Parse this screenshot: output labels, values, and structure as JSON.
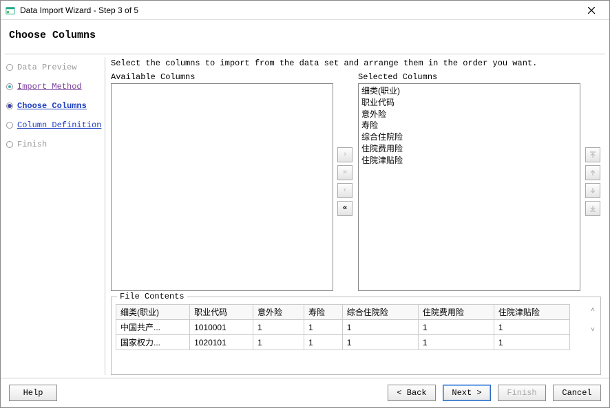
{
  "window": {
    "title": "Data Import Wizard - Step 3 of 5",
    "close_tooltip": "Close"
  },
  "header": {
    "heading": "Choose Columns"
  },
  "nav": {
    "items": [
      {
        "label": "Data Preview",
        "state": "visited_disabled"
      },
      {
        "label": "Import Method",
        "state": "visited"
      },
      {
        "label": "Choose Columns",
        "state": "current"
      },
      {
        "label": "Column Definition",
        "state": "link"
      },
      {
        "label": "Finish",
        "state": "disabled"
      }
    ]
  },
  "main": {
    "instruction": "Select the columns to import from the data set and arrange them in the order you want.",
    "available_label": "Available Columns",
    "selected_label": "Selected Columns",
    "available_columns": [],
    "selected_columns": [
      "细类(职业)",
      "职业代码",
      "意外险",
      "寿险",
      "综合住院险",
      "住院费用险",
      "住院津贴险"
    ],
    "move_buttons": {
      "add": "›",
      "add_all": "»",
      "remove": "‹",
      "remove_all": "«"
    },
    "order_buttons": {
      "top": "⤒",
      "up": "↑",
      "down": "↓",
      "bottom": "⤓"
    }
  },
  "file_contents": {
    "legend": "File Contents",
    "headers": [
      "细类(职业)",
      "职业代码",
      "意外险",
      "寿险",
      "综合住院险",
      "住院费用险",
      "住院津贴险"
    ],
    "rows": [
      [
        "中国共产...",
        "1010001",
        "1",
        "1",
        "1",
        "1",
        "1"
      ],
      [
        "国家权力...",
        "1020101",
        "1",
        "1",
        "1",
        "1",
        "1"
      ]
    ]
  },
  "footer": {
    "help": "Help",
    "back": "< Back",
    "next": "Next >",
    "finish": "Finish",
    "cancel": "Cancel"
  }
}
